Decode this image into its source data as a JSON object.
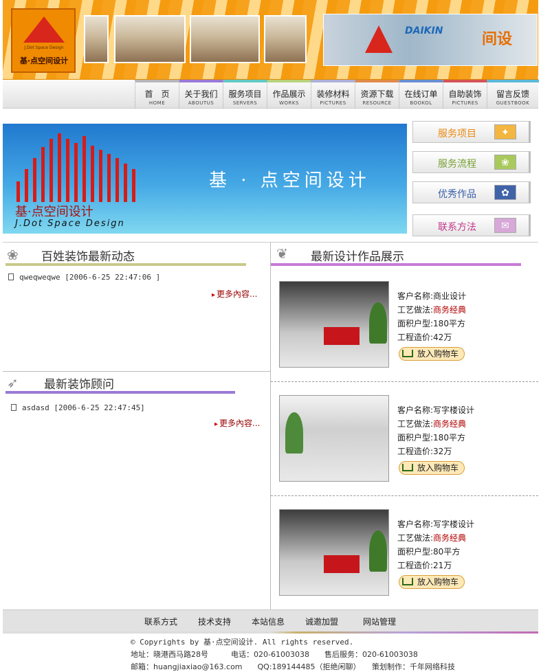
{
  "header": {
    "logo_sub": "J.Dot Space Design",
    "logo_name": "基·点空间设计",
    "brand_right": "DAIKIN",
    "brand_right_cn": "间设"
  },
  "nav": {
    "items": [
      {
        "cn": "首　页",
        "en": "HOME",
        "color": "#b7b7b7"
      },
      {
        "cn": "关于我们",
        "en": "ABOUTUS",
        "color": "#9a7ad6"
      },
      {
        "cn": "服务项目",
        "en": "SERVERS",
        "color": "#62c9c3"
      },
      {
        "cn": "作品展示",
        "en": "WORKS",
        "color": "#b9d27a"
      },
      {
        "cn": "装修材料",
        "en": "PICTURES",
        "color": "#aeb0d8"
      },
      {
        "cn": "资源下载",
        "en": "RESOURCE",
        "color": "#e08a4a"
      },
      {
        "cn": "在线订单",
        "en": "BOOKOL",
        "color": "#6a8fd1"
      },
      {
        "cn": "自助装饰",
        "en": "PICTURES",
        "color": "#d45454"
      },
      {
        "cn": "留言反馈",
        "en": "GUESTBOOK",
        "color": "#5db8d9"
      }
    ]
  },
  "banner": {
    "title": "基 · 点空间设计",
    "logo_cn": "基·点空间设计",
    "logo_en": "J.Dot Space Design"
  },
  "side_buttons": [
    {
      "label": "服务项目",
      "color": "#e88a10",
      "icon_bg": "#f3b640"
    },
    {
      "label": "服务流程",
      "color": "#78a030",
      "icon_bg": "#a9c95c"
    },
    {
      "label": "优秀作品",
      "color": "#3a5fa8",
      "icon_bg": "#3f62a8"
    },
    {
      "label": "联系方法",
      "color": "#c03a8a",
      "icon_bg": "#d7a8d8"
    }
  ],
  "left": {
    "news_title": "百姓装饰最新动态",
    "news_items": [
      {
        "text": "qweqweqwe [2006-6-25 22:47:06 ]"
      }
    ],
    "consult_title": "最新装饰顾问",
    "consult_items": [
      {
        "text": "asdasd [2006-6-25 22:47:45]"
      }
    ],
    "more": "更多內容..."
  },
  "right": {
    "title": "最新设计作品展示",
    "labels": {
      "client": "客户名称:",
      "craft": "工艺做法:",
      "area": "面积户型:",
      "cost": "工程造价:"
    },
    "cart_label": "放入购物车",
    "works": [
      {
        "client": "商业设计",
        "craft": "商务经典",
        "area": "180平方",
        "cost": "42万"
      },
      {
        "client": "写字楼设计",
        "craft": "商务经典",
        "area": "180平方",
        "cost": "32万"
      },
      {
        "client": "写字楼设计",
        "craft": "商务经典",
        "area": "80平方",
        "cost": "21万"
      }
    ]
  },
  "footer": {
    "links": [
      "联系方式",
      "技术支持",
      "本站信息",
      "诚邀加盟",
      "网站管理"
    ],
    "copyright": "© Copyrights by 基·点空间设计. All rights reserved.",
    "address": "地址：晓港西马路28号　　　电话：020-61003038　　售后服务：020-61003038",
    "email_line": "邮箱：huangjiaxiao@163.com　　QQ:189144485（拒绝闲聊）　　策划制作：千年网络科技"
  }
}
